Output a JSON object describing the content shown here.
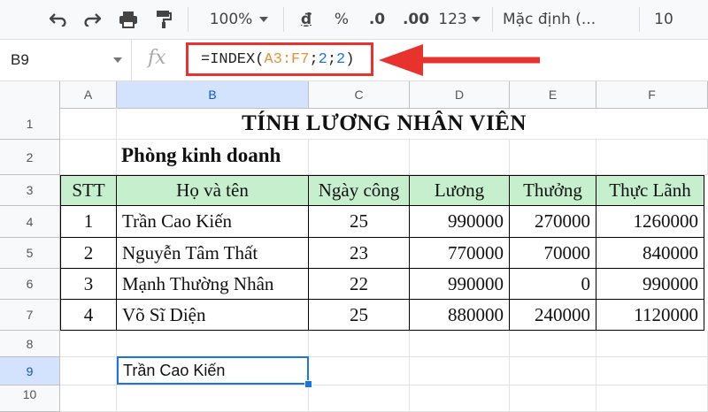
{
  "toolbar": {
    "zoom": "100%",
    "currency": "₫",
    "percent": "%",
    "dec_decrease": ".0",
    "dec_increase": ".00",
    "more_formats": "123",
    "font": "Mặc định (...",
    "font_size": "10"
  },
  "formula_bar": {
    "name_box": "B9",
    "fx": "fx",
    "formula_prefix": "=INDEX(",
    "formula_range": "A3:F7",
    "formula_sep1": ";",
    "formula_arg2": "2",
    "formula_sep2": ";",
    "formula_arg3": "2",
    "formula_suffix": ")"
  },
  "annotation": {
    "arrow_color": "#e8322d"
  },
  "columns": [
    "A",
    "B",
    "C",
    "D",
    "E",
    "F"
  ],
  "rows": [
    "1",
    "2",
    "3",
    "4",
    "5",
    "6",
    "7",
    "8",
    "9",
    "10"
  ],
  "sheet": {
    "title": "TÍNH LƯƠNG NHÂN VIÊN",
    "subtitle": "Phòng kinh doanh",
    "headers": [
      "STT",
      "Họ và tên",
      "Ngày công",
      "Lương",
      "Thưởng",
      "Thực Lãnh"
    ],
    "data": [
      [
        "1",
        "Trần Cao Kiến",
        "25",
        "990000",
        "270000",
        "1260000"
      ],
      [
        "2",
        "Nguyễn Tâm Thất",
        "23",
        "770000",
        "70000",
        "840000"
      ],
      [
        "3",
        "Mạnh Thường Nhân",
        "22",
        "990000",
        "0",
        "990000"
      ],
      [
        "4",
        "Võ Sĩ Diện",
        "25",
        "880000",
        "240000",
        "1120000"
      ]
    ],
    "result_cell": "Trần Cao Kiến"
  },
  "colors": {
    "header_fill": "#c6efce",
    "selection": "#1a73e8",
    "highlight_header": "#d3e3fd"
  }
}
